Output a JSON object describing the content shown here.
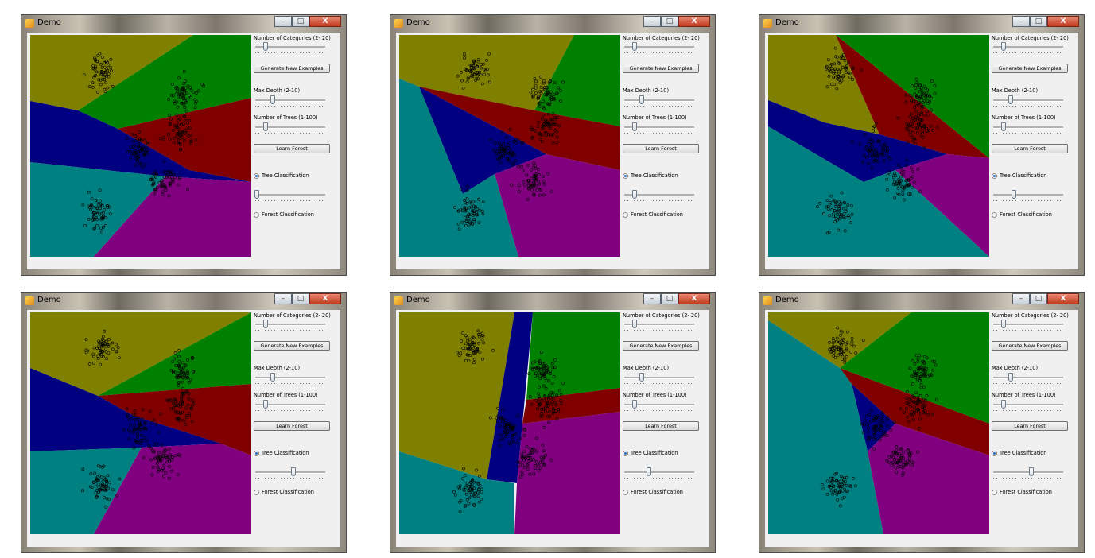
{
  "window": {
    "title": "Demo",
    "minimize_icon": "minimize-icon",
    "maximize_icon": "maximize-icon",
    "close_icon": "close-icon",
    "close_glyph": "X"
  },
  "controls": {
    "categories_label": "Number of Categories (2- 20)",
    "generate_button": "Generate New Examples",
    "max_depth_label": "Max Depth (2-10)",
    "trees_label": "Number of Trees (1-100)",
    "learn_button": "Learn Forest",
    "tree_radio": "Tree Classification",
    "forest_radio": "Forest Classification"
  },
  "colors": {
    "olive": "#808000",
    "green": "#008000",
    "maroon": "#800000",
    "navy": "#000080",
    "teal": "#008080",
    "purple": "#800080",
    "point_stroke": "#000000"
  },
  "screenshots": [
    {
      "categories_slider": 0.15,
      "max_depth_slider": 0.25,
      "trees_slider": 0.15,
      "tree_slider": 0.02,
      "tree_selected": true
    },
    {
      "categories_slider": 0.15,
      "max_depth_slider": 0.25,
      "trees_slider": 0.15,
      "tree_slider": 0.15,
      "tree_selected": true
    },
    {
      "categories_slider": 0.15,
      "max_depth_slider": 0.25,
      "trees_slider": 0.15,
      "tree_slider": 0.3,
      "tree_selected": true
    },
    {
      "categories_slider": 0.15,
      "max_depth_slider": 0.25,
      "trees_slider": 0.15,
      "tree_slider": 0.55,
      "tree_selected": true
    },
    {
      "categories_slider": 0.15,
      "max_depth_slider": 0.25,
      "trees_slider": 0.15,
      "tree_slider": 0.35,
      "tree_selected": true
    },
    {
      "categories_slider": 0.15,
      "max_depth_slider": 0.25,
      "trees_slider": 0.15,
      "tree_slider": 0.55,
      "tree_selected": true
    }
  ]
}
